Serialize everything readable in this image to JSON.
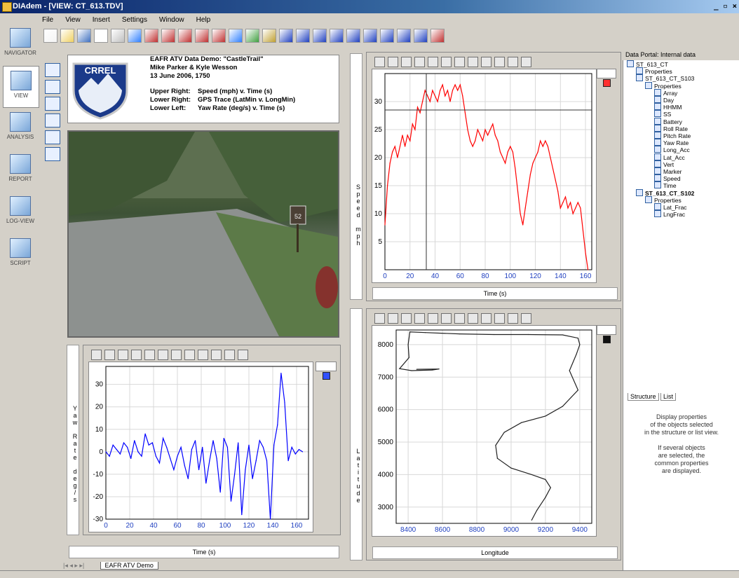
{
  "window": {
    "title": "DIAdem - [VIEW:  CT_613.TDV]",
    "controls": "_ ▫ ×"
  },
  "menu": [
    "File",
    "View",
    "Insert",
    "Settings",
    "Window",
    "Help"
  ],
  "navigator": [
    {
      "label": "NAVIGATOR",
      "icon": "navigator-icon",
      "active": false
    },
    {
      "label": "VIEW",
      "icon": "view-icon",
      "active": true
    },
    {
      "label": "ANALYSIS",
      "icon": "analysis-icon",
      "active": false
    },
    {
      "label": "REPORT",
      "icon": "report-icon",
      "active": false
    },
    {
      "label": "LOG-VIEW",
      "icon": "logview-icon",
      "active": false
    },
    {
      "label": "SCRIPT",
      "icon": "script-icon",
      "active": false
    }
  ],
  "header": {
    "logo_text": "CRREL",
    "line1": "EAFR ATV Data Demo: \"CastleTrail\"",
    "line2": "Mike Parker & Kyle Wesson",
    "line3": "13 June 2006, 1750",
    "rows": [
      {
        "k": "Upper Right:",
        "v": "Speed (mph) v. Time (s)"
      },
      {
        "k": "Lower Right:",
        "v": "GPS Trace (LatMin v. LongMin)"
      },
      {
        "k": "Lower Left:",
        "v": "Yaw Rate (deg/s) v. Time (s)"
      }
    ]
  },
  "video": {
    "sign_text": "52"
  },
  "colors": {
    "speed": "#ff0000",
    "yaw": "#0000ff",
    "gps": "#202020",
    "plot_bg": "#ffffff",
    "grid": "#d8d8d8"
  },
  "speed_panel": {
    "xlabel": "Time (s)",
    "ylabel": "Speed mph"
  },
  "yaw_panel": {
    "xlabel": "Time (s)",
    "ylabel": "Yaw Rate deg/s"
  },
  "gps_panel": {
    "xlabel": "Longitude",
    "ylabel": "Latitude"
  },
  "chart_data": [
    {
      "type": "line",
      "xlabel": "Time (s)",
      "ylabel": "Speed mph",
      "xlim": [
        0,
        165
      ],
      "ylim": [
        0,
        35
      ],
      "xticks": [
        0,
        20,
        40,
        60,
        80,
        100,
        120,
        140,
        160
      ],
      "yticks": [
        5,
        10,
        15,
        20,
        25,
        30
      ],
      "cursor": {
        "x": 33,
        "y": 28.5
      },
      "x": [
        0,
        2,
        4,
        6,
        8,
        10,
        12,
        14,
        16,
        18,
        20,
        22,
        24,
        26,
        28,
        30,
        32,
        34,
        36,
        38,
        40,
        42,
        44,
        46,
        48,
        50,
        52,
        54,
        56,
        58,
        60,
        62,
        64,
        66,
        68,
        70,
        72,
        74,
        76,
        78,
        80,
        82,
        84,
        86,
        88,
        90,
        92,
        94,
        96,
        98,
        100,
        102,
        104,
        106,
        108,
        110,
        112,
        114,
        116,
        118,
        120,
        122,
        124,
        126,
        128,
        130,
        132,
        134,
        136,
        138,
        140,
        142,
        144,
        146,
        148,
        150,
        152,
        154,
        156,
        158,
        160,
        162
      ],
      "y": [
        8,
        15,
        19,
        21,
        22,
        20,
        22,
        24,
        22,
        24,
        23,
        26,
        25,
        29,
        28,
        30,
        32,
        31,
        30,
        32,
        31,
        30,
        32,
        33,
        31,
        32,
        30,
        32,
        33,
        32,
        33,
        31,
        28,
        25,
        23,
        22,
        23,
        25,
        24,
        23,
        25,
        24,
        25,
        26,
        24,
        23,
        21,
        20,
        19,
        21,
        22,
        21,
        18,
        14,
        10,
        8,
        11,
        14,
        17,
        19,
        20,
        21,
        23,
        22,
        23,
        22,
        20,
        18,
        16,
        14,
        11,
        12,
        13,
        11,
        12,
        10,
        11,
        12,
        11,
        7,
        3,
        0
      ]
    },
    {
      "type": "line",
      "xlabel": "Time (s)",
      "ylabel": "Yaw Rate deg/s",
      "xlim": [
        0,
        170
      ],
      "ylim": [
        -30,
        38
      ],
      "xticks": [
        0,
        20,
        40,
        60,
        80,
        100,
        120,
        140,
        160
      ],
      "yticks": [
        -30,
        -20,
        -10,
        0,
        10,
        20,
        30
      ],
      "x": [
        0,
        3,
        6,
        9,
        12,
        15,
        18,
        21,
        24,
        27,
        30,
        33,
        36,
        39,
        42,
        45,
        48,
        51,
        54,
        57,
        60,
        63,
        66,
        69,
        72,
        75,
        78,
        81,
        84,
        87,
        90,
        93,
        96,
        99,
        102,
        105,
        108,
        111,
        114,
        117,
        120,
        123,
        126,
        129,
        132,
        135,
        138,
        141,
        144,
        147,
        150,
        153,
        156,
        159,
        162,
        165
      ],
      "y": [
        0,
        -2,
        3,
        1,
        -1,
        4,
        2,
        -3,
        5,
        0,
        -2,
        8,
        3,
        4,
        -2,
        -5,
        6,
        2,
        -3,
        -8,
        -2,
        2,
        -6,
        -12,
        1,
        5,
        -8,
        2,
        -14,
        -4,
        5,
        -3,
        -18,
        6,
        2,
        -22,
        -10,
        4,
        -28,
        -8,
        3,
        -12,
        -4,
        5,
        2,
        -4,
        -30,
        3,
        12,
        35,
        22,
        -4,
        2,
        -1,
        1,
        0
      ]
    },
    {
      "type": "line",
      "xlabel": "Longitude",
      "ylabel": "Latitude",
      "xlim": [
        8330,
        9470
      ],
      "ylim": [
        2500,
        8450
      ],
      "xticks": [
        8400,
        8600,
        8800,
        9000,
        9200,
        9400
      ],
      "yticks": [
        3000,
        4000,
        5000,
        6000,
        7000,
        8000
      ],
      "x": [
        9120,
        9150,
        9200,
        9230,
        9200,
        9120,
        9000,
        8920,
        8910,
        8960,
        9060,
        9200,
        9300,
        9390,
        9340,
        9380,
        9400,
        9390,
        9300,
        9100,
        8900,
        8700,
        8500,
        8410,
        8400,
        8405,
        8350,
        8420,
        8540,
        8580,
        8450
      ],
      "y": [
        2600,
        2900,
        3300,
        3600,
        3850,
        4000,
        4200,
        4500,
        4900,
        5300,
        5600,
        5800,
        6100,
        6600,
        7200,
        7700,
        8000,
        8200,
        8300,
        8310,
        8310,
        8330,
        8370,
        8390,
        8000,
        7600,
        7260,
        7200,
        7220,
        7250,
        7240
      ]
    }
  ],
  "portal": {
    "title": "Data Portal: Internal data",
    "tree": [
      {
        "label": "ST_613_CT",
        "indent": 0,
        "bold": false
      },
      {
        "label": "Properties",
        "indent": 1,
        "bold": false
      },
      {
        "label": "ST_613_CT_S103",
        "indent": 1,
        "bold": false
      },
      {
        "label": "Properties",
        "indent": 2,
        "bold": false
      },
      {
        "label": "Array",
        "indent": 3,
        "bold": false
      },
      {
        "label": "Day",
        "indent": 3,
        "bold": false
      },
      {
        "label": "HHMM",
        "indent": 3,
        "bold": false
      },
      {
        "label": "SS",
        "indent": 3,
        "bold": false
      },
      {
        "label": "Battery",
        "indent": 3,
        "bold": false
      },
      {
        "label": "Roll Rate",
        "indent": 3,
        "bold": false
      },
      {
        "label": "Pitch Rate",
        "indent": 3,
        "bold": false
      },
      {
        "label": "Yaw Rate",
        "indent": 3,
        "bold": false
      },
      {
        "label": "Long_Acc",
        "indent": 3,
        "bold": false
      },
      {
        "label": "Lat_Acc",
        "indent": 3,
        "bold": false
      },
      {
        "label": "Vert",
        "indent": 3,
        "bold": false
      },
      {
        "label": "Marker",
        "indent": 3,
        "bold": false
      },
      {
        "label": "Speed",
        "indent": 3,
        "bold": false
      },
      {
        "label": "Time",
        "indent": 3,
        "bold": false
      },
      {
        "label": "ST_613_CT_S102",
        "indent": 1,
        "bold": true
      },
      {
        "label": "Properties",
        "indent": 2,
        "bold": false
      },
      {
        "label": "Lat_Frac",
        "indent": 3,
        "bold": false
      },
      {
        "label": "LngFrac",
        "indent": 3,
        "bold": false
      }
    ],
    "tabs": [
      "Structure",
      "List"
    ],
    "help": [
      "Display properties",
      "of the objects selected",
      "in the structure or list view.",
      "",
      "If several objects",
      "are selected, the",
      "common properties",
      "are displayed."
    ]
  },
  "bottom": {
    "sheet_tab": "EAFR ATV Demo"
  }
}
